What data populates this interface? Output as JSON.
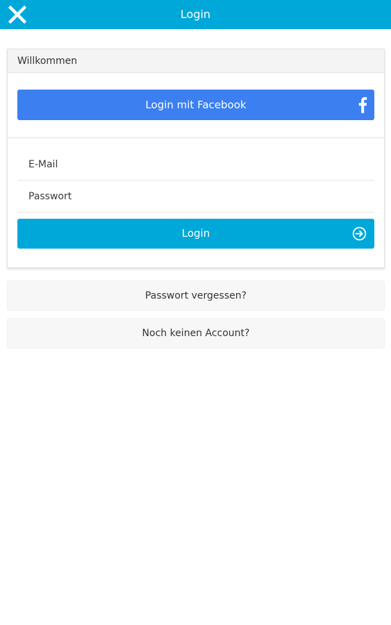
{
  "header": {
    "title": "Login",
    "close_icon": "close-icon",
    "background_color": "#00a8d9"
  },
  "card": {
    "header_title": "Willkommen",
    "facebook_button": {
      "label": "Login mit Facebook",
      "icon": "facebook-icon",
      "color": "#3b7ff0"
    },
    "email_field": {
      "placeholder": "E-Mail",
      "value": ""
    },
    "password_field": {
      "placeholder": "Passwort",
      "value": ""
    },
    "login_button": {
      "label": "Login",
      "icon": "sign-in-icon",
      "color": "#00a8d9"
    }
  },
  "links": {
    "forgot_password": "Passwort vergessen?",
    "no_account": "Noch keinen Account?"
  }
}
